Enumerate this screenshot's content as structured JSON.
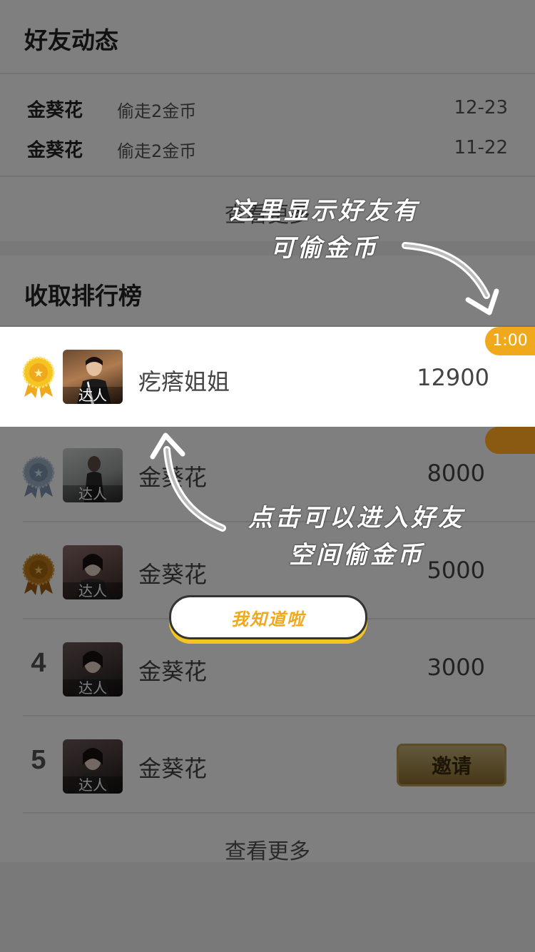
{
  "feed": {
    "title": "好友动态",
    "items": [
      {
        "name": "金葵花",
        "action": "偷走2金币",
        "date": "12-23"
      },
      {
        "name": "金葵花",
        "action": "偷走2金币",
        "date": "11-22"
      }
    ],
    "more": "查看更多"
  },
  "ranking": {
    "title": "收取排行榜",
    "avatar_tag": "达人",
    "items": [
      {
        "rank": "1",
        "badge": "gold-medal-icon",
        "name": "疙瘩姐姐",
        "score": "12900"
      },
      {
        "rank": "2",
        "badge": "silver-medal-icon",
        "name": "金葵花",
        "score": "8000"
      },
      {
        "rank": "3",
        "badge": "bronze-medal-icon",
        "name": "金葵花",
        "score": "5000"
      },
      {
        "rank": "4",
        "name": "金葵花",
        "score": "3000"
      },
      {
        "rank": "5",
        "name": "金葵花",
        "invite_label": "邀请"
      }
    ],
    "more": "查看更多"
  },
  "timer": "1:00",
  "guide": {
    "hint_top_line1": "这里显示好友有",
    "hint_top_line2": "可偷金币",
    "hint_bottom_line1": "点击可以进入好友",
    "hint_bottom_line2": "空间偷金币",
    "confirm_label": "我知道啦"
  },
  "colors": {
    "accent": "#f0a81d",
    "gold": "#f4c520",
    "silver": "#9fb3c8",
    "bronze": "#c07a1a",
    "overlay": "rgba(0,0,0,0.5)"
  }
}
